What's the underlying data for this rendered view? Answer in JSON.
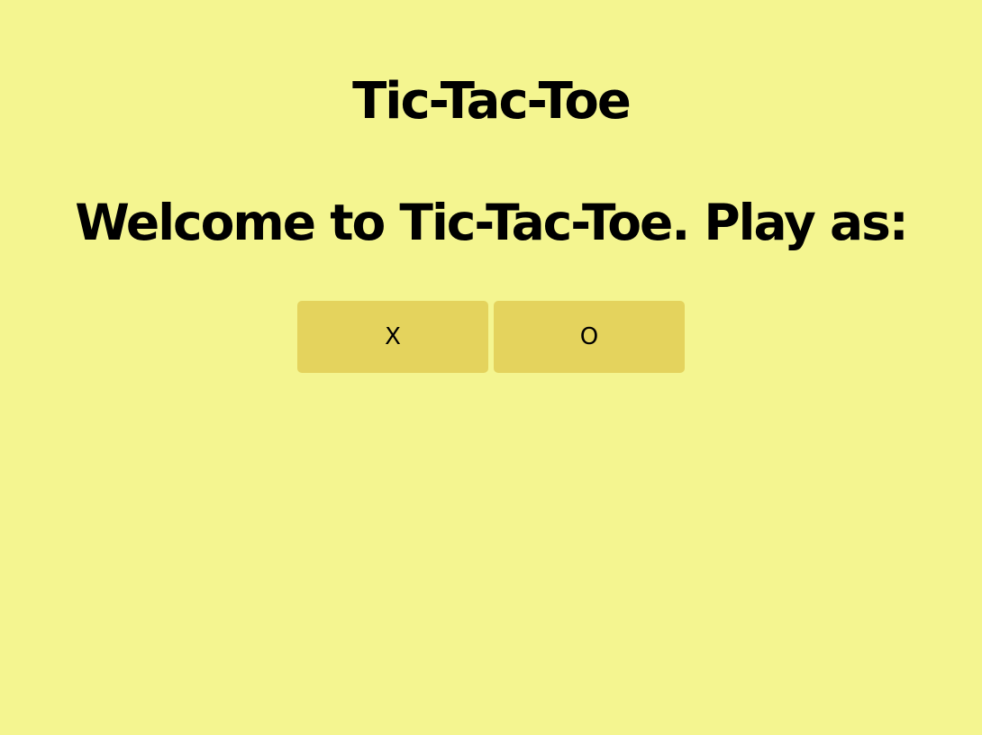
{
  "app": {
    "title": "Tic-Tac-Toe"
  },
  "welcome": {
    "text": "Welcome to Tic-Tac-Toe. Play as:"
  },
  "choices": [
    {
      "label": "X"
    },
    {
      "label": "O"
    }
  ],
  "colors": {
    "background": "#f4f590",
    "button": "#e4d35d",
    "text": "#000000"
  }
}
